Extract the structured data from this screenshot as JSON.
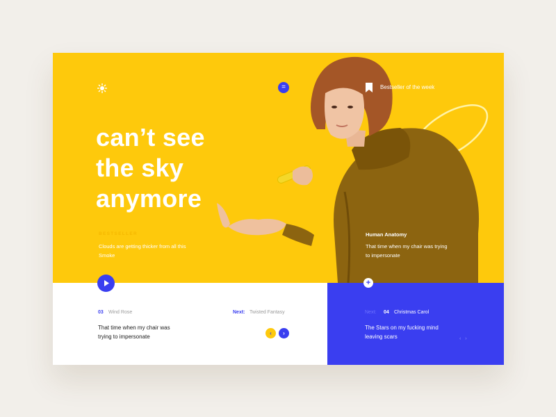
{
  "header": {
    "logo_icon": "sun-icon",
    "menu_icon": "equals-icon",
    "menu_glyph": "=",
    "bookmark_icon": "bookmark-icon",
    "bestseller_label": "Bestseller of the week"
  },
  "hero": {
    "headline": [
      "can’t see",
      "the sky",
      "anymore"
    ],
    "kicker": "BESTSELLER",
    "subtitle": "Clouds are getting thicker from all this Smoke",
    "book_title": "Human Anatomy",
    "book_desc": "That time when my chair was trying to impersonate",
    "play_icon": "play-icon",
    "plus_glyph": "+"
  },
  "current_track": {
    "number": "03",
    "name": "Wind Rose",
    "next_label": "Next:",
    "next_name": "Twisted Fantasy",
    "description": "That time when my chair was trying to impersonate",
    "prev_glyph": "‹",
    "next_glyph": "›"
  },
  "next_track": {
    "next_label": "Next:",
    "number": "04",
    "name": "Christmas Carol",
    "description": "The Stars on my fucking mind leaving scars",
    "arrows": "‹ ›"
  },
  "colors": {
    "yellow": "#fec90c",
    "blue": "#3a3ef0",
    "background": "#f2efea"
  }
}
